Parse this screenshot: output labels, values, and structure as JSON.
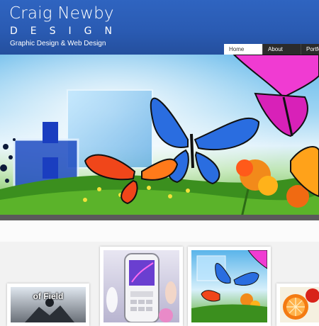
{
  "header": {
    "logo_line1": "Craig Newby",
    "logo_line2": "DESIGN",
    "tagline": "Graphic Design & Web Design",
    "background_color": "#2a5bb3"
  },
  "nav": {
    "items": [
      "Home",
      "About",
      "Portfo"
    ],
    "active_index": 0
  },
  "hero": {
    "image": "butterflies-illustration"
  },
  "thumbnails": [
    {
      "caption": "of Field",
      "image": "depth-of-field-figure"
    },
    {
      "caption": "",
      "image": "mobile-phone-illustration"
    },
    {
      "caption": "",
      "image": "butterflies-thumbnail"
    },
    {
      "caption": "",
      "image": "citrus-fruit"
    }
  ]
}
